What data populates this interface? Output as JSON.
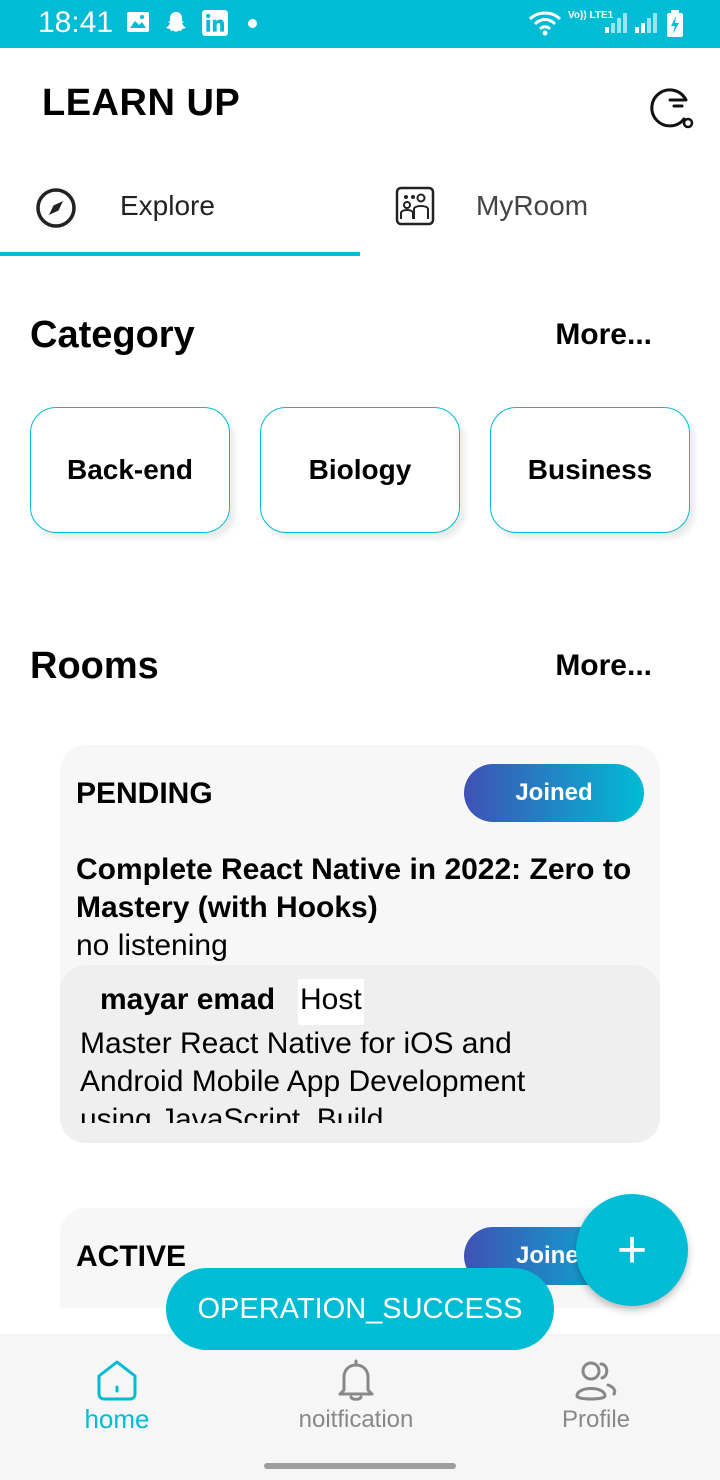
{
  "status_bar": {
    "time": "18:41",
    "network": "Vo)) LTE1",
    "background": "#00BCD4"
  },
  "header": {
    "title": "LEARN UP",
    "action_icon": "timer-search-icon"
  },
  "tabs": [
    {
      "label": "Explore",
      "icon": "compass-icon",
      "active": true
    },
    {
      "label": "MyRoom",
      "icon": "room-people-icon",
      "active": false
    }
  ],
  "category": {
    "title": "Category",
    "more": "More...",
    "items": [
      "Back-end",
      "Biology",
      "Business"
    ]
  },
  "rooms": {
    "title": "Rooms",
    "more": "More...",
    "items": [
      {
        "status": "PENDING",
        "button": "Joined",
        "title": "Complete React Native in 2022: Zero to Mastery (with Hooks)",
        "subtitle": "no listening",
        "host_name": "mayar emad",
        "host_tag": "Host",
        "description": "Master React Native for iOS and Android Mobile App Development using JavaScript. Build"
      },
      {
        "status": "ACTIVE",
        "button": "Joined"
      }
    ]
  },
  "fab": {
    "label": "+"
  },
  "toast": {
    "message": "OPERATION_SUCCESS"
  },
  "bottom_nav": [
    {
      "label": "home",
      "icon": "home-icon",
      "active": true
    },
    {
      "label": "noitfication",
      "icon": "bell-icon",
      "active": false
    },
    {
      "label": "Profile",
      "icon": "users-icon",
      "active": false
    }
  ],
  "colors": {
    "accent": "#00BCD4",
    "gradient_start": "#3F51B5",
    "gradient_end": "#00BCD4"
  }
}
